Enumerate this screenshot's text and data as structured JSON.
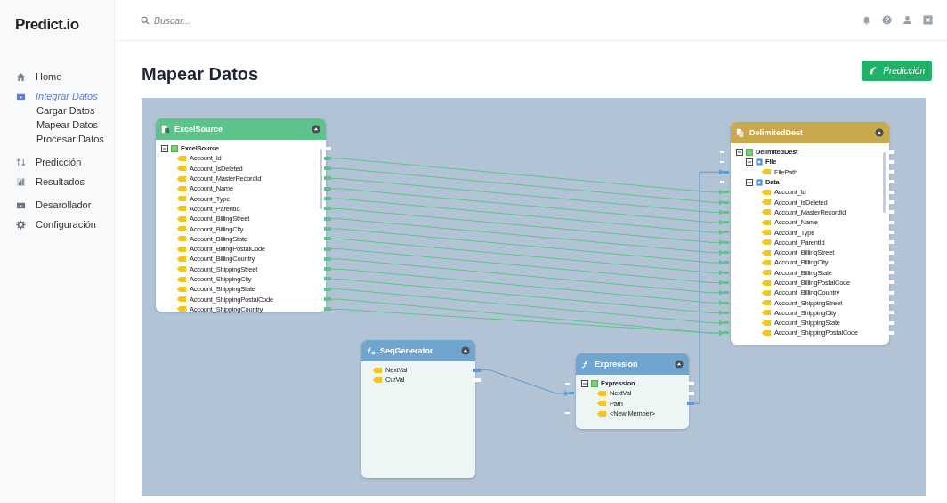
{
  "brand": "Predict.io",
  "search": {
    "placeholder": "Buscar..."
  },
  "nav_groups": [
    {
      "items": [
        {
          "label": "Home",
          "selected": false
        },
        {
          "label": "Integrar Datos",
          "selected": true,
          "children": [
            {
              "label": "Cargar Datos"
            },
            {
              "label": "Mapear Datos"
            },
            {
              "label": "Procesar Datos"
            }
          ]
        }
      ]
    },
    {
      "items": [
        {
          "label": "Predicción",
          "selected": false
        },
        {
          "label": "Resultados",
          "selected": false
        }
      ]
    },
    {
      "items": [
        {
          "label": "Desarollador",
          "selected": false
        },
        {
          "label": "Configuración",
          "selected": false
        }
      ]
    }
  ],
  "page": {
    "title": "Mapear Datos",
    "action": "Predicción"
  },
  "nodes": [
    {
      "kind": "source",
      "title": "ExcelSource",
      "color": "#5ec38a",
      "tree": [
        {
          "kind": "root",
          "label": "ExcelSource",
          "expanded": true,
          "out": {
            "color": "#ffffff"
          },
          "children": [
            {
              "kind": "field",
              "label": "Account_Id",
              "out": {
                "color": "#5ec38a"
              }
            },
            {
              "kind": "field",
              "label": "Account_IsDeleted",
              "out": {
                "color": "#5ec38a"
              }
            },
            {
              "kind": "field",
              "label": "Account_MasterRecordId",
              "out": {
                "color": "#5ec38a"
              }
            },
            {
              "kind": "field",
              "label": "Account_Name",
              "out": {
                "color": "#5ec38a"
              }
            },
            {
              "kind": "field",
              "label": "Account_Type",
              "out": {
                "color": "#5ec38a"
              }
            },
            {
              "kind": "field",
              "label": "Account_ParentId",
              "out": {
                "color": "#5ec38a"
              }
            },
            {
              "kind": "field",
              "label": "Account_BillingStreet",
              "out": {
                "color": "#5ec38a"
              }
            },
            {
              "kind": "field",
              "label": "Account_BillingCity",
              "out": {
                "color": "#5ec38a"
              }
            },
            {
              "kind": "field",
              "label": "Account_BillingState",
              "out": {
                "color": "#5ec38a"
              }
            },
            {
              "kind": "field",
              "label": "Account_BillingPostalCode",
              "out": {
                "color": "#5ec38a"
              }
            },
            {
              "kind": "field",
              "label": "Account_BillingCountry",
              "out": {
                "color": "#5ec38a"
              }
            },
            {
              "kind": "field",
              "label": "Account_ShippingStreet",
              "out": {
                "color": "#5ec38a"
              }
            },
            {
              "kind": "field",
              "label": "Account_ShippingCity",
              "out": {
                "color": "#5ec38a"
              }
            },
            {
              "kind": "field",
              "label": "Account_ShippingState",
              "out": {
                "color": "#5ec38a"
              }
            },
            {
              "kind": "field",
              "label": "Account_ShippingPostalCode",
              "out": {
                "color": "#5ec38a"
              }
            },
            {
              "kind": "field",
              "label": "Account_ShippingCountry",
              "out": {
                "color": "#5ec38a"
              }
            }
          ]
        }
      ]
    },
    {
      "kind": "destination",
      "title": "DelimitedDest",
      "color": "#c9a94c",
      "tree": [
        {
          "kind": "root",
          "label": "DelimitedDest",
          "expanded": true,
          "in": {
            "color": "#ffffff"
          },
          "out": {
            "color": "#ffffff"
          },
          "children": [
            {
              "kind": "group",
              "label": "File",
              "expanded": true,
              "in": {
                "color": "#ffffff"
              },
              "out": {
                "color": "#ffffff"
              },
              "children": [
                {
                  "kind": "field",
                  "label": "FilePath",
                  "in": {
                    "color": "#5b9bd3"
                  },
                  "out": {
                    "color": "#ffffff"
                  }
                }
              ]
            },
            {
              "kind": "group",
              "label": "Data",
              "expanded": true,
              "in": {
                "color": "#ffffff"
              },
              "out": {
                "color": "#ffffff"
              },
              "children": [
                {
                  "kind": "field",
                  "label": "Account_Id",
                  "in": {
                    "color": "#5ec38a"
                  },
                  "out": {
                    "color": "#ffffff"
                  }
                },
                {
                  "kind": "field",
                  "label": "Account_IsDeleted",
                  "in": {
                    "color": "#5ec38a"
                  },
                  "out": {
                    "color": "#ffffff"
                  }
                },
                {
                  "kind": "field",
                  "label": "Account_MasterRecordId",
                  "in": {
                    "color": "#5ec38a"
                  },
                  "out": {
                    "color": "#ffffff"
                  }
                },
                {
                  "kind": "field",
                  "label": "Account_Name",
                  "in": {
                    "color": "#5ec38a"
                  },
                  "out": {
                    "color": "#ffffff"
                  }
                },
                {
                  "kind": "field",
                  "label": "Account_Type",
                  "in": {
                    "color": "#5ec38a"
                  },
                  "out": {
                    "color": "#ffffff"
                  }
                },
                {
                  "kind": "field",
                  "label": "Account_ParentId",
                  "in": {
                    "color": "#5ec38a"
                  },
                  "out": {
                    "color": "#ffffff"
                  }
                },
                {
                  "kind": "field",
                  "label": "Account_BillingStreet",
                  "in": {
                    "color": "#5ec38a"
                  },
                  "out": {
                    "color": "#ffffff"
                  }
                },
                {
                  "kind": "field",
                  "label": "Account_BillingCity",
                  "in": {
                    "color": "#5ec38a"
                  },
                  "out": {
                    "color": "#ffffff"
                  }
                },
                {
                  "kind": "field",
                  "label": "Account_BillingState",
                  "in": {
                    "color": "#5ec38a"
                  },
                  "out": {
                    "color": "#ffffff"
                  }
                },
                {
                  "kind": "field",
                  "label": "Account_BillingPostalCode",
                  "in": {
                    "color": "#5ec38a"
                  },
                  "out": {
                    "color": "#ffffff"
                  }
                },
                {
                  "kind": "field",
                  "label": "Account_BillingCountry",
                  "in": {
                    "color": "#5ec38a"
                  },
                  "out": {
                    "color": "#ffffff"
                  }
                },
                {
                  "kind": "field",
                  "label": "Account_ShippingStreet",
                  "in": {
                    "color": "#5ec38a"
                  },
                  "out": {
                    "color": "#ffffff"
                  }
                },
                {
                  "kind": "field",
                  "label": "Account_ShippingCity",
                  "in": {
                    "color": "#5ec38a"
                  },
                  "out": {
                    "color": "#ffffff"
                  }
                },
                {
                  "kind": "field",
                  "label": "Account_ShippingState",
                  "in": {
                    "color": "#5ec38a"
                  },
                  "out": {
                    "color": "#ffffff"
                  }
                },
                {
                  "kind": "field",
                  "label": "Account_ShippingPostalCode",
                  "in": {
                    "color": "#5ec38a"
                  },
                  "out": {
                    "color": "#ffffff"
                  }
                }
              ]
            }
          ]
        }
      ]
    },
    {
      "kind": "generator",
      "title": "SeqGenerator",
      "color": "#6fa5cf",
      "tree": [
        {
          "kind": "field",
          "label": "NextVal",
          "out": {
            "color": "#5b9bd3"
          }
        },
        {
          "kind": "field",
          "label": "CurVal",
          "out": {
            "color": "#ffffff"
          }
        }
      ]
    },
    {
      "kind": "expression",
      "title": "Expression",
      "color": "#6fa5cf",
      "tree": [
        {
          "kind": "root",
          "label": "Expression",
          "expanded": true,
          "in": {
            "color": "#ffffff"
          },
          "out": {
            "color": "#ffffff"
          },
          "children": [
            {
              "kind": "field",
              "label": "NextVal",
              "in": {
                "color": "#5b9bd3"
              },
              "out": {
                "color": "#ffffff"
              }
            },
            {
              "kind": "field",
              "label": "Path",
              "out": {
                "color": "#5b9bd3"
              }
            },
            {
              "kind": "field",
              "label": "<New Member>",
              "in": {
                "color": "#ffffff"
              }
            }
          ]
        }
      ]
    }
  ]
}
